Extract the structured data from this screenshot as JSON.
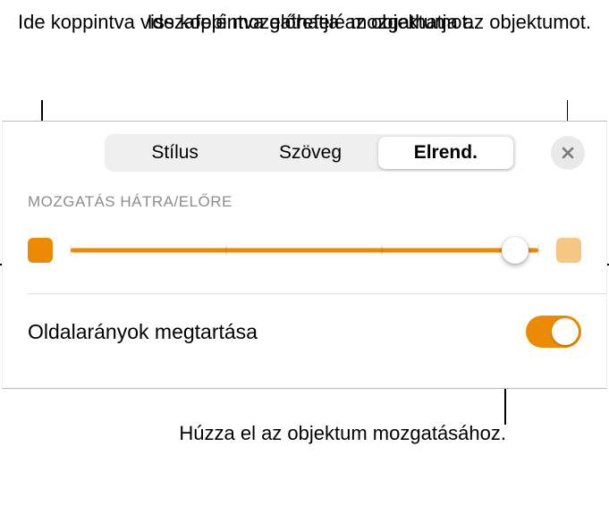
{
  "callouts": {
    "back": "Ide koppintva visszafelé mozgathatja az objektumot.",
    "front": "Ide koppintva előrefelé mozgathatja az objektumot.",
    "drag": "Húzza el az objektum mozgatásához."
  },
  "tabs": {
    "style": "Stílus",
    "text": "Szöveg",
    "arrange": "Elrend."
  },
  "section_label": "MOZGATÁS HÁTRA/ELŐRE",
  "toggle": {
    "label": "Oldalarányok megtartása",
    "state": "on"
  },
  "slider": {
    "value_percent": 95
  },
  "colors": {
    "accent": "#ec8a05",
    "accent_light": "#f6c783"
  }
}
